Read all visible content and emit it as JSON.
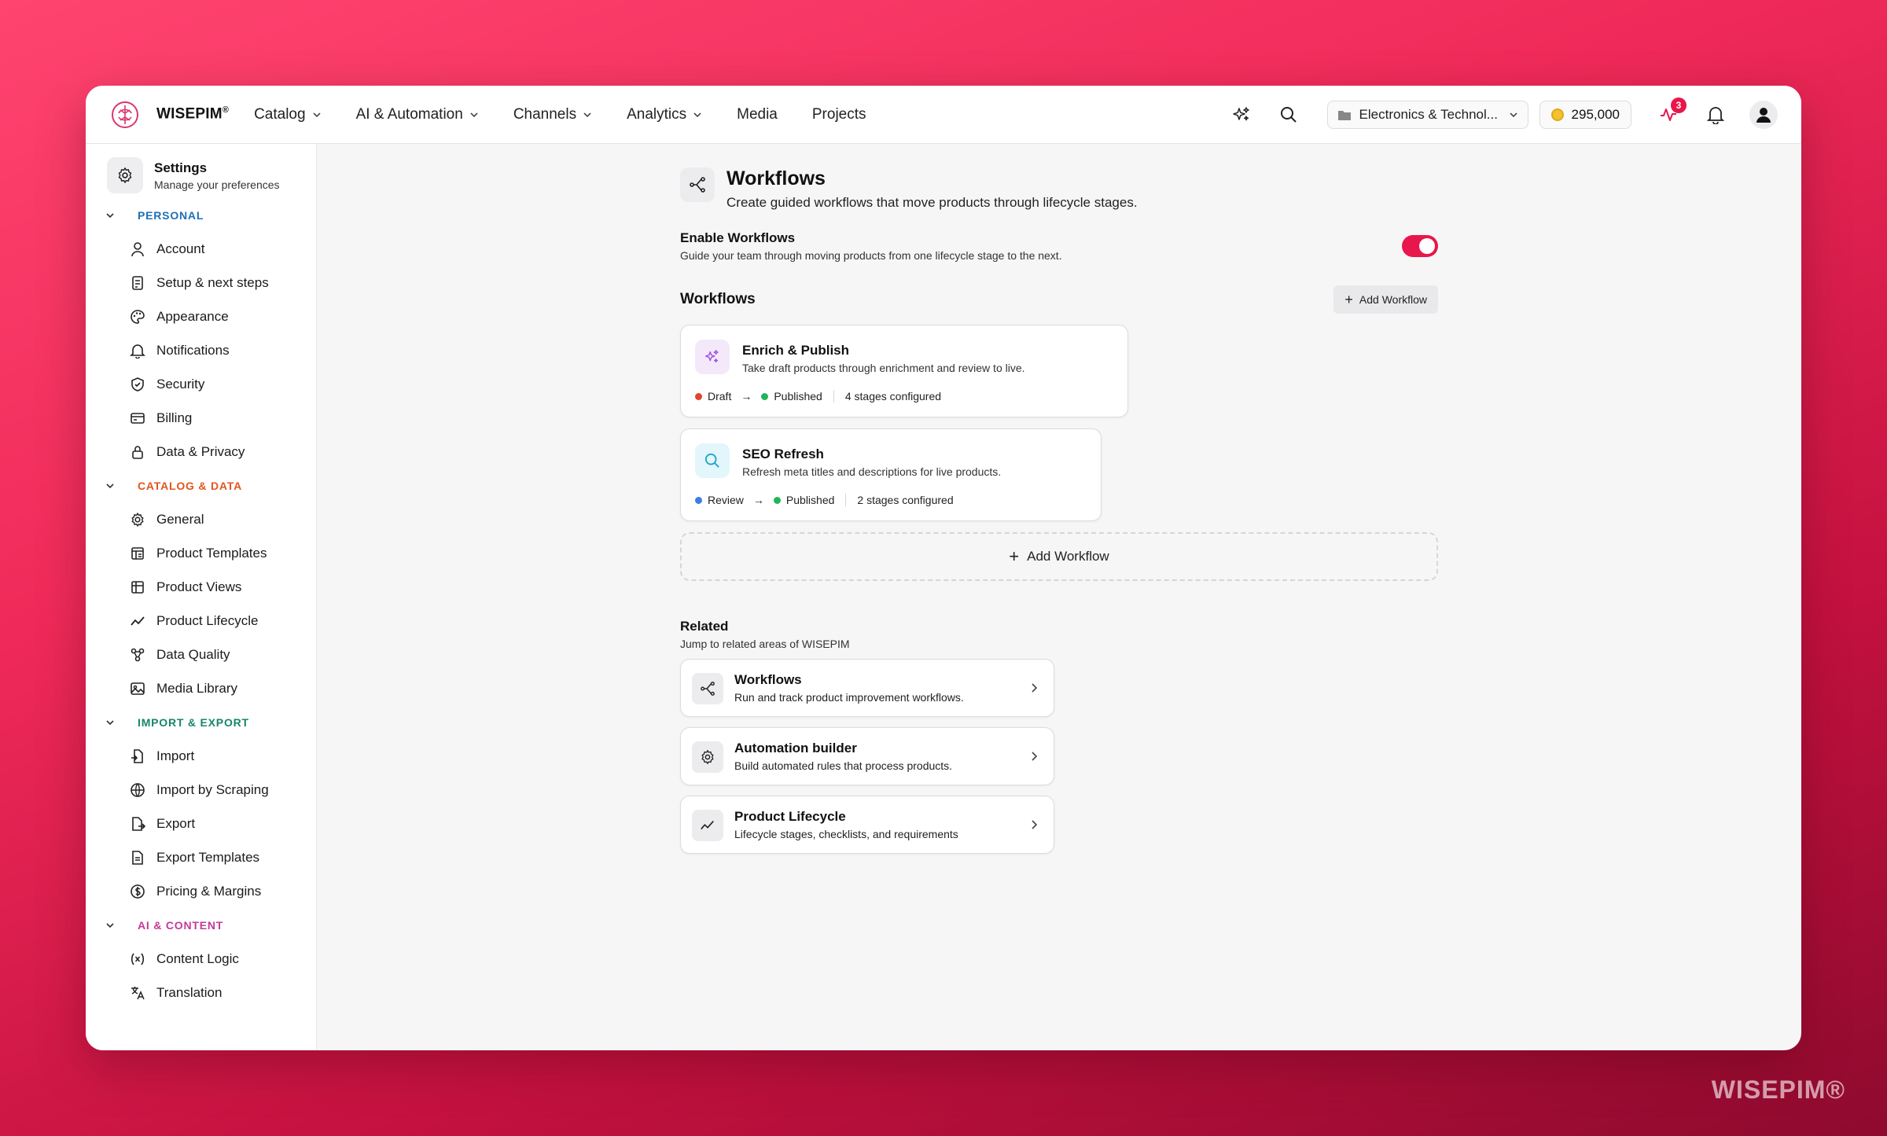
{
  "brand": {
    "name": "WISEPIM",
    "reg": "®"
  },
  "nav": [
    {
      "label": "Catalog",
      "dropdown": true
    },
    {
      "label": "AI & Automation",
      "dropdown": true
    },
    {
      "label": "Channels",
      "dropdown": true
    },
    {
      "label": "Analytics",
      "dropdown": true
    },
    {
      "label": "Media",
      "dropdown": false
    },
    {
      "label": "Projects",
      "dropdown": false
    }
  ],
  "topbar": {
    "org_select": "Electronics & Technol...",
    "credits": "295,000",
    "activity_badge": "3",
    "icons": [
      "ai-sparkles-icon",
      "search-icon",
      "activity-icon",
      "bell-icon",
      "user-avatar-icon"
    ]
  },
  "sidebar": {
    "title": "Settings",
    "subtitle": "Manage your preferences",
    "sections": [
      {
        "label": "PERSONAL",
        "color": "#1d6fb8",
        "items": [
          {
            "label": "Account",
            "icon": "user-icon"
          },
          {
            "label": "Setup & next steps",
            "icon": "checklist-icon"
          },
          {
            "label": "Appearance",
            "icon": "palette-icon"
          },
          {
            "label": "Notifications",
            "icon": "bell-icon"
          },
          {
            "label": "Security",
            "icon": "shield-icon"
          },
          {
            "label": "Billing",
            "icon": "credit-card-icon"
          },
          {
            "label": "Data & Privacy",
            "icon": "lock-icon"
          }
        ]
      },
      {
        "label": "CATALOG & DATA",
        "color": "#e0571f",
        "items": [
          {
            "label": "General",
            "icon": "gear-icon"
          },
          {
            "label": "Product Templates",
            "icon": "template-icon"
          },
          {
            "label": "Product Views",
            "icon": "table-icon"
          },
          {
            "label": "Product Lifecycle",
            "icon": "trend-icon"
          },
          {
            "label": "Data Quality",
            "icon": "nodes-icon"
          },
          {
            "label": "Media Library",
            "icon": "image-icon"
          }
        ]
      },
      {
        "label": "IMPORT & EXPORT",
        "color": "#16866a",
        "items": [
          {
            "label": "Import",
            "icon": "file-import-icon"
          },
          {
            "label": "Import by Scraping",
            "icon": "globe-icon"
          },
          {
            "label": "Export",
            "icon": "file-export-icon"
          },
          {
            "label": "Export Templates",
            "icon": "file-template-icon"
          },
          {
            "label": "Pricing & Margins",
            "icon": "dollar-icon"
          }
        ]
      },
      {
        "label": "AI & CONTENT",
        "color": "#c43a9a",
        "items": [
          {
            "label": "Content Logic",
            "icon": "variable-icon"
          },
          {
            "label": "Translation",
            "icon": "translate-icon"
          }
        ]
      }
    ]
  },
  "page": {
    "title": "Workflows",
    "subtitle": "Create guided workflows that move products through lifecycle stages.",
    "enable_title": "Enable Workflows",
    "enable_sub": "Guide your team through moving products from one lifecycle stage to the next.",
    "enabled": true,
    "section_title": "Workflows",
    "add_button": "Add Workflow",
    "add_dashed": "Add Workflow"
  },
  "workflows": [
    {
      "name": "Enrich & Publish",
      "desc": "Take draft products through enrichment and review to live.",
      "from": "Draft",
      "from_color": "#e0442e",
      "to": "Published",
      "to_color": "#22b45a",
      "stages": "4 stages configured",
      "icon": "sparkles-icon",
      "icon_bg": "#f3e9fb",
      "icon_color": "#a050e0"
    },
    {
      "name": "SEO Refresh",
      "desc": "Refresh meta titles and descriptions for live products.",
      "from": "Review",
      "from_color": "#3b7de8",
      "to": "Published",
      "to_color": "#22b45a",
      "stages": "2 stages configured",
      "icon": "search-icon",
      "icon_bg": "#e2f6fb",
      "icon_color": "#1ca6c8"
    }
  ],
  "related": {
    "title": "Related",
    "subtitle": "Jump to related areas of WISEPIM",
    "items": [
      {
        "name": "Workflows",
        "desc": "Run and track product improvement workflows.",
        "icon": "workflow-icon"
      },
      {
        "name": "Automation builder",
        "desc": "Build automated rules that process products.",
        "icon": "gear-icon"
      },
      {
        "name": "Product Lifecycle",
        "desc": "Lifecycle stages, checklists, and requirements",
        "icon": "trend-icon"
      }
    ]
  },
  "watermark": "WISEPIM®"
}
